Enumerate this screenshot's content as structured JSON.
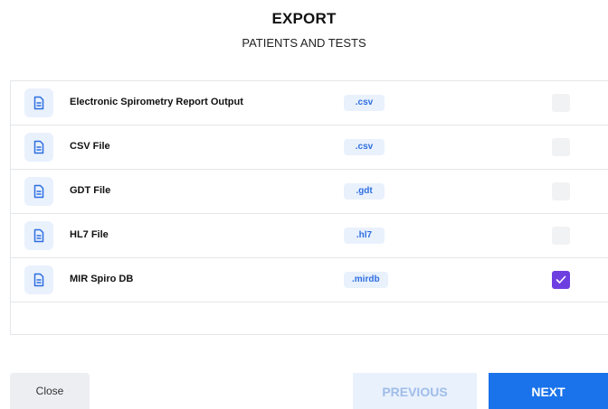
{
  "header": {
    "title": "EXPORT",
    "subtitle": "PATIENTS AND TESTS"
  },
  "formats": [
    {
      "name": "Electronic Spirometry Report Output",
      "extension": ".csv",
      "checked": false,
      "icon": "document-icon"
    },
    {
      "name": "CSV File",
      "extension": ".csv",
      "checked": false,
      "icon": "document-icon"
    },
    {
      "name": "GDT File",
      "extension": ".gdt",
      "checked": false,
      "icon": "document-icon"
    },
    {
      "name": "HL7 File",
      "extension": ".hl7",
      "checked": false,
      "icon": "document-icon"
    },
    {
      "name": "MIR Spiro DB",
      "extension": ".mirdb",
      "checked": true,
      "icon": "document-icon"
    }
  ],
  "footer": {
    "close_label": "Close",
    "previous_label": "PREVIOUS",
    "next_label": "NEXT",
    "previous_enabled": false
  },
  "colors": {
    "accent": "#1a73ea",
    "checkbox_checked": "#6e3fe0",
    "badge_bg": "#e9f1fd",
    "badge_text": "#2e6fe0"
  }
}
